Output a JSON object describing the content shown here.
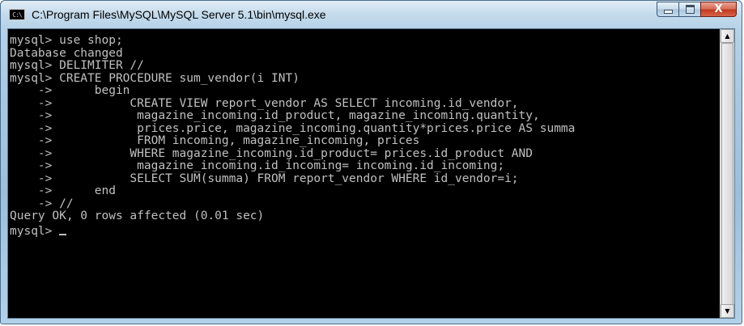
{
  "window": {
    "title": "C:\\Program Files\\MySQL\\MySQL Server 5.1\\bin\\mysql.exe",
    "app_icon_text": "C:\\"
  },
  "controls": {
    "close_glyph": "X"
  },
  "console": {
    "lines": [
      "mysql> use shop;",
      "Database changed",
      "mysql> DELIMITER //",
      "mysql> CREATE PROCEDURE sum_vendor(i INT)",
      "    ->      begin",
      "    ->           CREATE VIEW report_vendor AS SELECT incoming.id_vendor,",
      "    ->            magazine_incoming.id_product, magazine_incoming.quantity,",
      "    ->            prices.price, magazine_incoming.quantity*prices.price AS summa",
      "    ->            FROM incoming, magazine_incoming, prices",
      "    ->           WHERE magazine_incoming.id_product= prices.id_product AND",
      "    ->            magazine_incoming.id_incoming= incoming.id_incoming;",
      "    ->           SELECT SUM(summa) FROM report_vendor WHERE id_vendor=i;",
      "    ->      end",
      "    -> //",
      "Query OK, 0 rows affected (0.01 sec)"
    ],
    "prompt": "mysql> "
  },
  "scrollbar": {
    "up_glyph": "▲",
    "down_glyph": "▼"
  },
  "colors": {
    "console_bg": "#000000",
    "console_fg": "#c0c0c0",
    "close_button": "#c2391f"
  }
}
